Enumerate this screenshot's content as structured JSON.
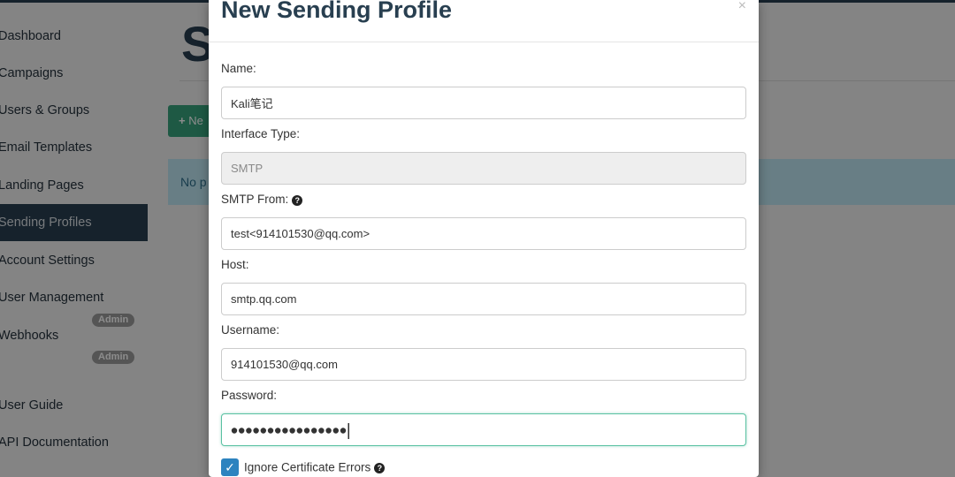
{
  "sidebar": {
    "items": [
      {
        "label": "Dashboard"
      },
      {
        "label": "Campaigns"
      },
      {
        "label": "Users & Groups"
      },
      {
        "label": "Email Templates"
      },
      {
        "label": "Landing Pages"
      },
      {
        "label": "Sending Profiles",
        "active": true
      },
      {
        "label": "Account Settings"
      },
      {
        "label": "User Management",
        "badge": "Admin"
      },
      {
        "label": "Webhooks",
        "badge": "Admin"
      },
      {
        "label": "User Guide"
      },
      {
        "label": "API Documentation"
      }
    ]
  },
  "main": {
    "title": "S",
    "new_button_label": "Ne",
    "new_button_icon": "plus-icon",
    "alert_text": "No p"
  },
  "modal": {
    "title": "New Sending Profile",
    "close_glyph": "×",
    "fields": {
      "name": {
        "label": "Name:",
        "value": "Kali笔记"
      },
      "interface_type": {
        "label": "Interface Type:",
        "value": "SMTP"
      },
      "smtp_from": {
        "label": "SMTP From:",
        "value": "test<914101530@qq.com>",
        "help_icon": "question-circle-icon"
      },
      "host": {
        "label": "Host:",
        "value": "smtp.qq.com"
      },
      "username": {
        "label": "Username:",
        "value": "914101530@qq.com"
      },
      "password": {
        "label": "Password:",
        "masked_length": 16
      }
    },
    "ignore_cert": {
      "label": "Ignore Certificate Errors",
      "checked": true,
      "help_icon": "question-circle-icon"
    }
  },
  "colors": {
    "sidebar_active_bg": "#283f50",
    "primary_button": "#37a37d",
    "checkbox": "#2d83bf",
    "focus_border": "#5ac1a2",
    "title": "#283f50"
  }
}
